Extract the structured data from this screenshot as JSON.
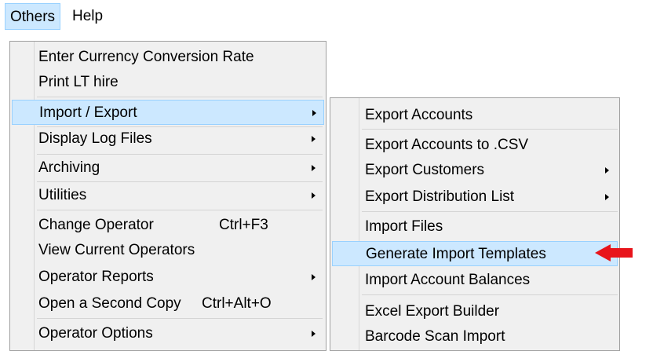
{
  "menubar": {
    "others": "Others",
    "help": "Help"
  },
  "main_menu": {
    "enter_currency": "Enter Currency Conversion Rate",
    "print_lt_hire": "Print LT hire",
    "import_export": "Import / Export",
    "display_log_files": "Display Log Files",
    "archiving": "Archiving",
    "utilities": "Utilities",
    "change_operator": "Change Operator",
    "change_operator_shortcut": "Ctrl+F3",
    "view_current_operators": "View Current Operators",
    "operator_reports": "Operator Reports",
    "open_second_copy": "Open a Second Copy",
    "open_second_copy_shortcut": "Ctrl+Alt+O",
    "operator_options": "Operator Options"
  },
  "sub_menu": {
    "export_accounts": "Export Accounts",
    "export_accounts_csv": "Export Accounts to .CSV",
    "export_customers": "Export Customers",
    "export_distribution_list": "Export Distribution List",
    "import_files": "Import Files",
    "generate_import_templates": "Generate Import Templates",
    "import_account_balances": "Import Account Balances",
    "excel_export_builder": "Excel Export Builder",
    "barcode_scan_import": "Barcode Scan Import"
  },
  "colors": {
    "highlight": "#cce8ff",
    "highlight_border": "#99d1ff",
    "menu_bg": "#f0f0f0",
    "pointer": "#e8141b"
  }
}
